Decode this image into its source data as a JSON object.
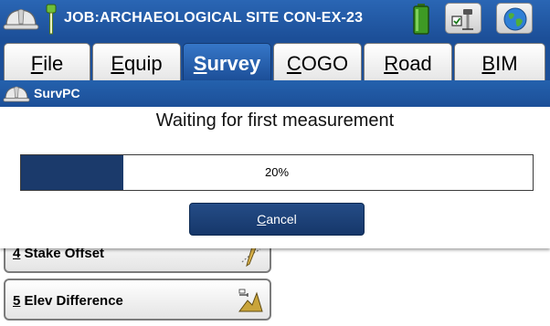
{
  "app": {
    "job_title": "JOB:ARCHAEOLOGICAL SITE CON-EX-23",
    "icons": [
      "hard-hat-icon",
      "gnss-rover-icon",
      "battery-icon",
      "instrument-settings-icon",
      "globe-icon"
    ]
  },
  "tabs": [
    {
      "key": "F",
      "rest": "ile",
      "active": false
    },
    {
      "key": "E",
      "rest": "quip",
      "active": false
    },
    {
      "key": "S",
      "rest": "urvey",
      "active": true
    },
    {
      "key": "C",
      "rest": "OGO",
      "active": false
    },
    {
      "key": "R",
      "rest": "oad",
      "active": false
    },
    {
      "key": "B",
      "rest": "IM",
      "active": false
    }
  ],
  "menu": {
    "items": [
      {
        "number": "4",
        "label": "Stake Offset",
        "icon": "stake-offset-icon"
      },
      {
        "number": "5",
        "label": "Elev Difference",
        "icon": "elevation-difference-icon"
      }
    ]
  },
  "dialog": {
    "title": "SurvPC",
    "message": "Waiting for first measurement",
    "progress_percent": 20,
    "progress_label": "20%",
    "cancel_key": "C",
    "cancel_rest": "ancel"
  },
  "colors": {
    "brand_blue": "#1c4f98",
    "progress_fill": "#1b3a6b",
    "button_navy": "#16376a"
  }
}
